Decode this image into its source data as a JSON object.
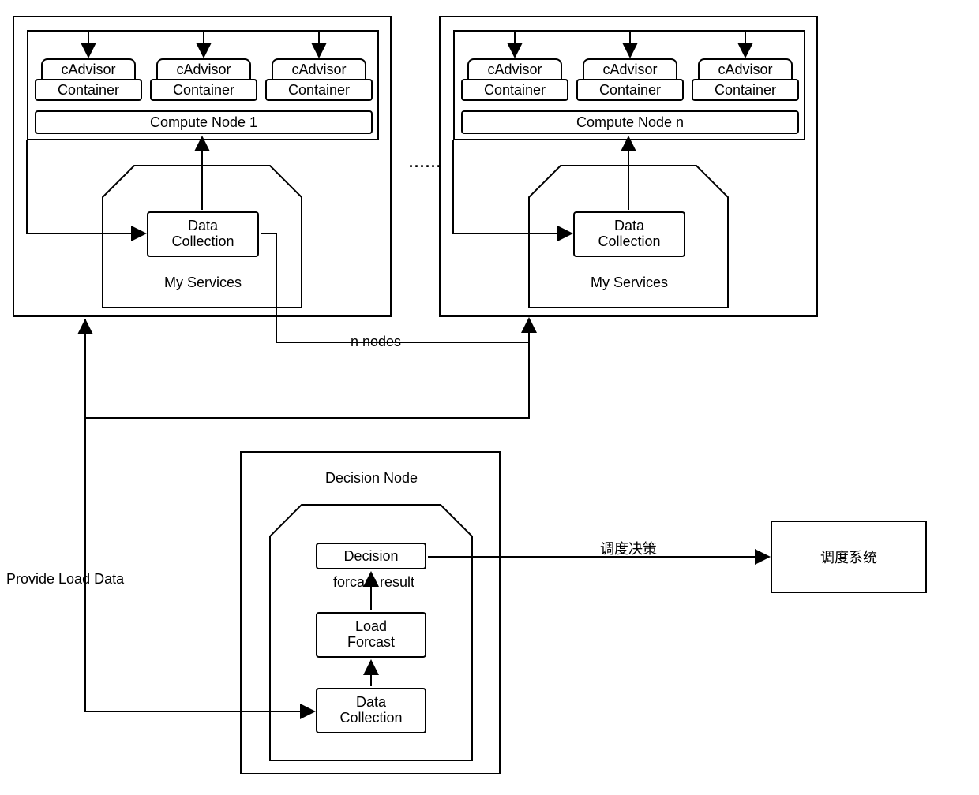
{
  "node1": {
    "cadvisor": "cAdvisor",
    "container": "Container",
    "compute": "Compute Node 1",
    "data_collection_l1": "Data",
    "data_collection_l2": "Collection",
    "my_services": "My Services"
  },
  "noden": {
    "cadvisor": "cAdvisor",
    "container": "Container",
    "compute": "Compute Node n",
    "data_collection_l1": "Data",
    "data_collection_l2": "Collection",
    "my_services": "My Services"
  },
  "connectors": {
    "ellipsis": "......",
    "n_nodes": "n nodes",
    "provide_load_data": "Provide Load Data",
    "schedule_decision": "调度决策"
  },
  "decision": {
    "title": "Decision Node",
    "decision": "Decision",
    "forecast_result": "forcast result",
    "load_l1": "Load",
    "load_l2": "Forcast",
    "data_l1": "Data",
    "data_l2": "Collection"
  },
  "scheduler": "调度系统"
}
